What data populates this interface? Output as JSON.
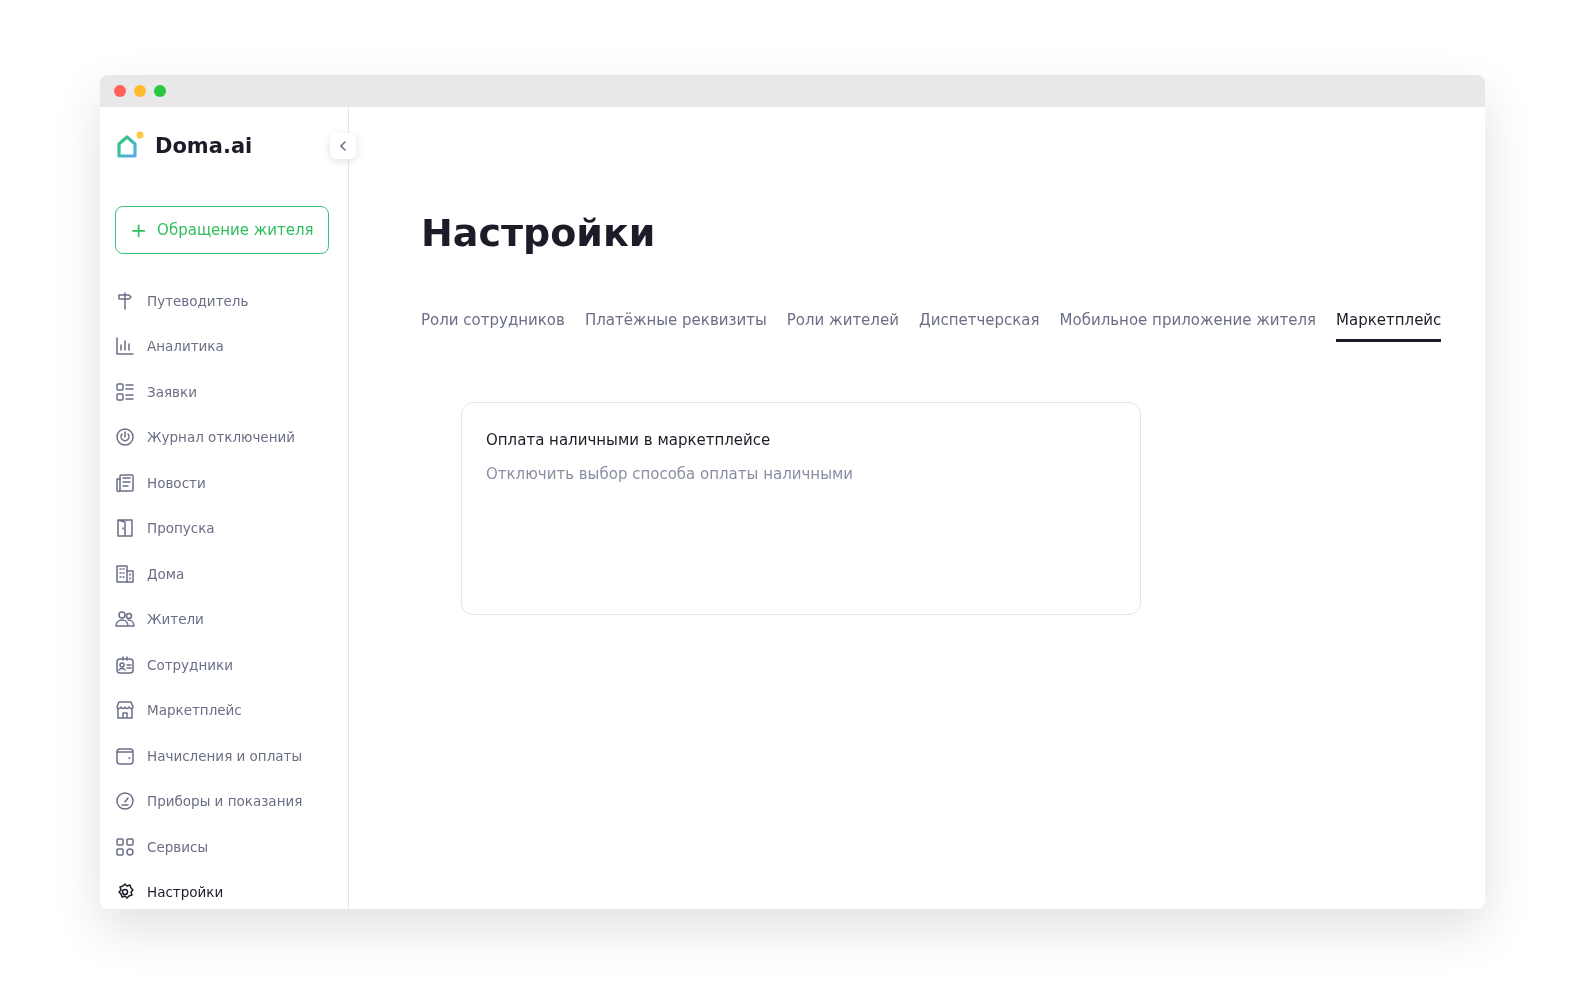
{
  "logo": {
    "text": "Doma.ai"
  },
  "new_request_button": {
    "label": "Обращение жителя",
    "icon": "+"
  },
  "sidebar": {
    "items": [
      {
        "label": "Путеводитель",
        "selected": false
      },
      {
        "label": "Аналитика",
        "selected": false
      },
      {
        "label": "Заявки",
        "selected": false
      },
      {
        "label": "Журнал отключений",
        "selected": false
      },
      {
        "label": "Новости",
        "selected": false
      },
      {
        "label": "Пропуска",
        "selected": false
      },
      {
        "label": "Дома",
        "selected": false
      },
      {
        "label": "Жители",
        "selected": false
      },
      {
        "label": "Сотрудники",
        "selected": false
      },
      {
        "label": "Маркетплейс",
        "selected": false
      },
      {
        "label": "Начисления и оплаты",
        "selected": false
      },
      {
        "label": "Приборы и показания",
        "selected": false
      },
      {
        "label": "Сервисы",
        "selected": false
      },
      {
        "label": "Настройки",
        "selected": true
      }
    ]
  },
  "page": {
    "title": "Настройки"
  },
  "tabs": [
    {
      "label": "Роли сотрудников",
      "selected": false
    },
    {
      "label": "Платёжные реквизиты",
      "selected": false
    },
    {
      "label": "Роли жителей",
      "selected": false
    },
    {
      "label": "Диспетчерская",
      "selected": false
    },
    {
      "label": "Мобильное приложение жителя",
      "selected": false
    },
    {
      "label": "Маркетплейс",
      "selected": true
    }
  ],
  "card": {
    "title": "Оплата наличными в маркетплейсе",
    "description": "Отключить выбор способа оплаты наличными"
  }
}
